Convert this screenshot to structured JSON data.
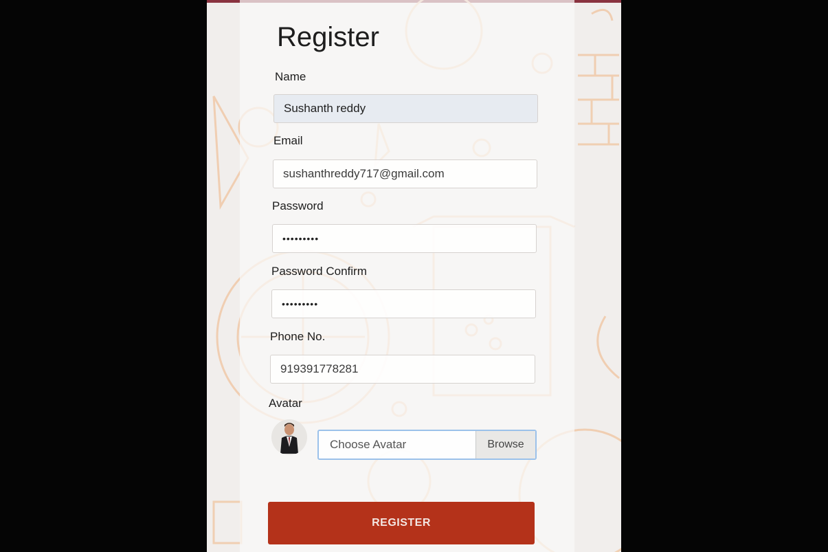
{
  "form": {
    "title": "Register",
    "name_label": "Name",
    "name_value": "Sushanth reddy",
    "email_label": "Email",
    "email_value": "sushanthreddy717@gmail.com",
    "password_label": "Password",
    "password_value": "•••••••••",
    "password_confirm_label": "Password Confirm",
    "password_confirm_value": "•••••••••",
    "phone_label": "Phone No.",
    "phone_value": "919391778281",
    "avatar_label": "Avatar",
    "avatar_placeholder": "Choose Avatar",
    "browse_label": "Browse",
    "submit_label": "REGISTER"
  },
  "colors": {
    "submit_button": "#b4321a",
    "focus_border": "#9bc1ea",
    "pattern_stroke": "#f0c9a8",
    "filled_input": "#e7ebf1"
  },
  "icons": {
    "avatar": "businessman-avatar-image"
  }
}
